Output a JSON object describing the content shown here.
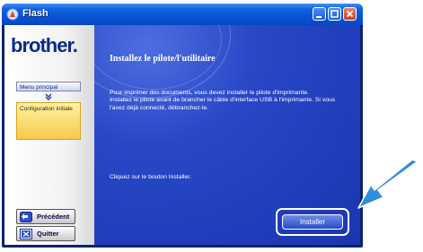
{
  "window": {
    "title": "Flash"
  },
  "sidebar": {
    "logo": "brother.",
    "menu_main": "Menu principal",
    "menu_current": "Configuration initiale",
    "prev_button": "Précédent",
    "quit_button": "Quitter"
  },
  "content": {
    "heading": "Installez le pilote/l'utilitaire",
    "paragraph1": "Pour imprimer des documents, vous devez installer le pilote d'imprimante.",
    "paragraph2": "Installez le pilote avant de brancher le câble d'interface USB à l'imprimante. Si vous l'avez déjà connecté, débranchez-le.",
    "instruction": "Cliquez sur le bouton Installer.",
    "install_button": "Installer"
  },
  "colors": {
    "titlebar": "#0a52d6",
    "content_bg": "#2848c8",
    "arrow": "#2f8de0",
    "menu_current_bg": "#f7c84a"
  },
  "icons": [
    "flash-icon",
    "minimize-icon",
    "maximize-icon",
    "close-icon",
    "back-arrow-icon",
    "quit-icon",
    "chevron-down-icon",
    "pointer-arrow-icon"
  ]
}
